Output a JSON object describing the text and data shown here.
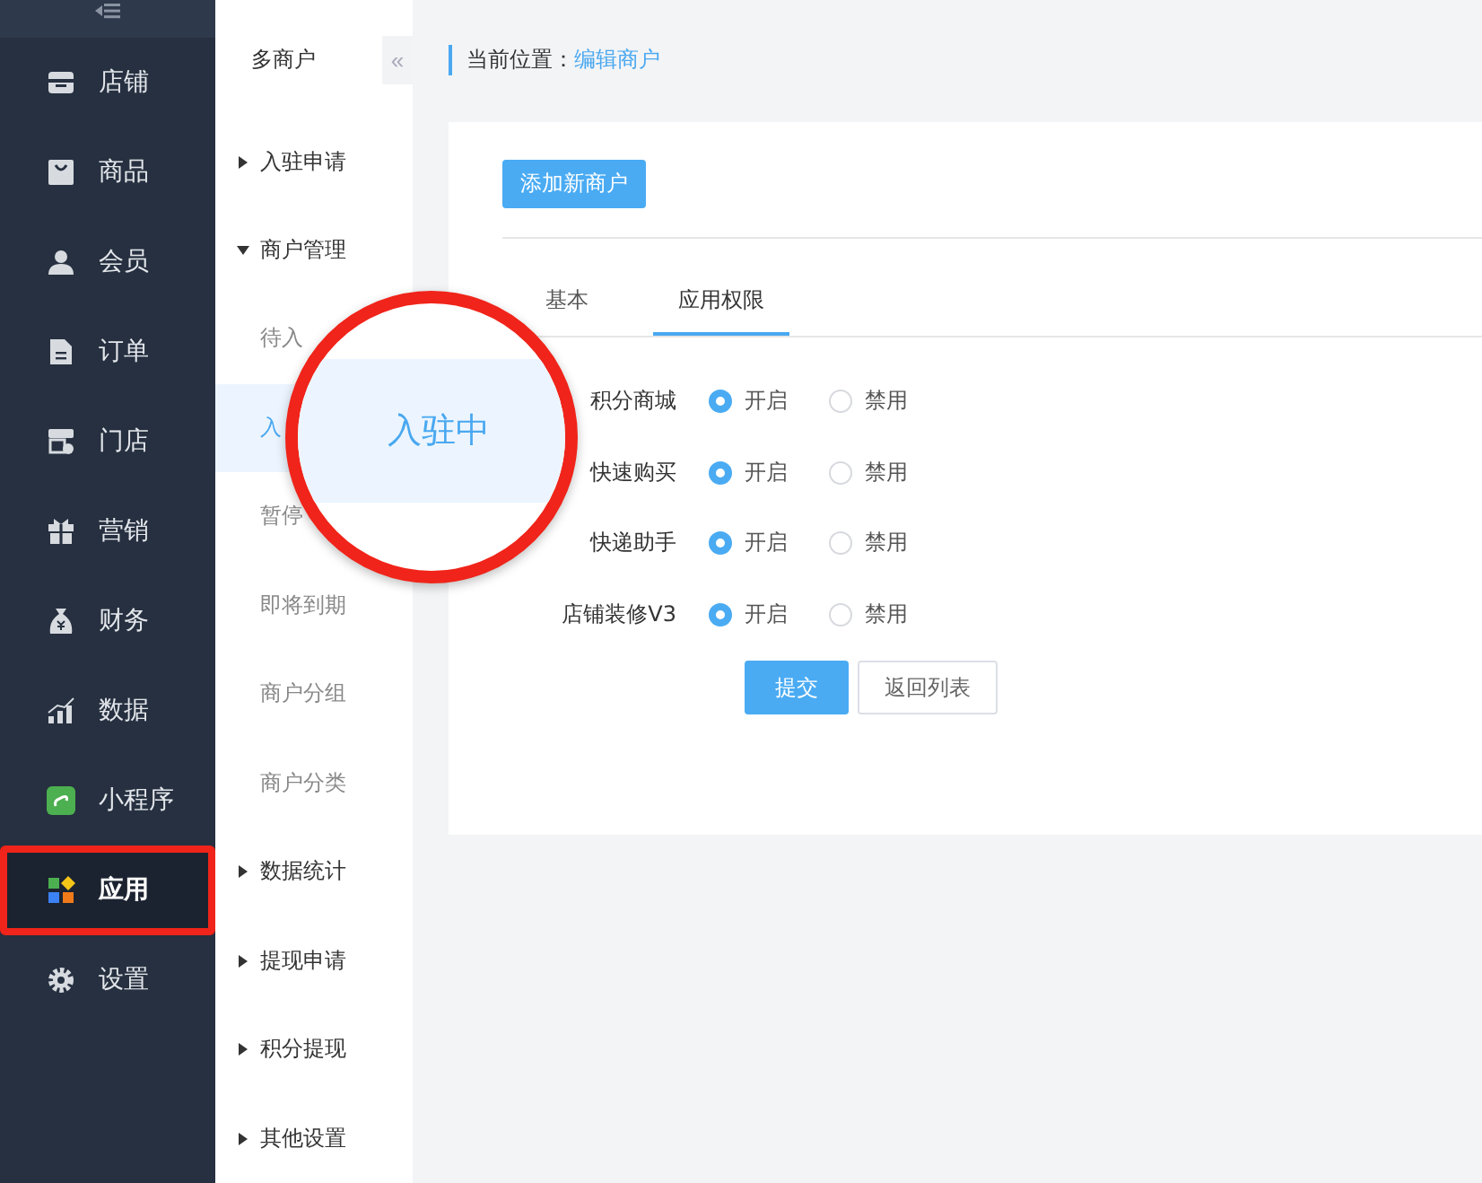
{
  "sidebar": {
    "collapse_icon": true,
    "items": [
      {
        "label": "店铺",
        "selected": false,
        "highlighted": false
      },
      {
        "label": "商品",
        "selected": false,
        "highlighted": false
      },
      {
        "label": "会员",
        "selected": false,
        "highlighted": false
      },
      {
        "label": "订单",
        "selected": false,
        "highlighted": false
      },
      {
        "label": "门店",
        "selected": false,
        "highlighted": false
      },
      {
        "label": "营销",
        "selected": false,
        "highlighted": false
      },
      {
        "label": "财务",
        "selected": false,
        "highlighted": false
      },
      {
        "label": "数据",
        "selected": false,
        "highlighted": false
      },
      {
        "label": "小程序",
        "selected": false,
        "highlighted": false
      },
      {
        "label": "应用",
        "selected": true,
        "highlighted": true
      },
      {
        "label": "设置",
        "selected": false,
        "highlighted": false
      }
    ]
  },
  "submenu": {
    "title": "多商户",
    "collapse_button": "«",
    "items": [
      {
        "label": "入驻申请",
        "expanded": false
      },
      {
        "label": "商户管理",
        "expanded": true,
        "children": [
          {
            "label": "待入",
            "selected": false
          },
          {
            "label": "入",
            "selected": true
          },
          {
            "label": "暂停",
            "selected": false
          },
          {
            "label": "即将到期",
            "selected": false
          },
          {
            "label": "商户分组",
            "selected": false
          },
          {
            "label": "商户分类",
            "selected": false
          }
        ]
      },
      {
        "label": "数据统计",
        "expanded": false
      },
      {
        "label": "提现申请",
        "expanded": false
      },
      {
        "label": "积分提现",
        "expanded": false
      },
      {
        "label": "其他设置",
        "expanded": false
      }
    ]
  },
  "breadcrumb": {
    "label": "当前位置：",
    "link": "编辑商户"
  },
  "add_button": "添加新商户",
  "tabs": [
    {
      "label": "基本",
      "selected": false
    },
    {
      "label": "应用权限",
      "selected": true
    }
  ],
  "permissions": [
    {
      "label": "积分商城",
      "options": [
        {
          "label": "开启",
          "selected": true
        },
        {
          "label": "禁用",
          "selected": false
        }
      ]
    },
    {
      "label": "快速购买",
      "options": [
        {
          "label": "开启",
          "selected": true
        },
        {
          "label": "禁用",
          "selected": false
        }
      ]
    },
    {
      "label": "快递助手",
      "options": [
        {
          "label": "开启",
          "selected": true
        },
        {
          "label": "禁用",
          "selected": false
        }
      ]
    },
    {
      "label": "店铺装修V3",
      "options": [
        {
          "label": "开启",
          "selected": true
        },
        {
          "label": "禁用",
          "selected": false
        }
      ]
    }
  ],
  "buttons": [
    {
      "label": "提交",
      "kind": "primary"
    },
    {
      "label": "返回列表",
      "kind": "default"
    }
  ],
  "magnifier": {
    "label": "入驻中"
  }
}
